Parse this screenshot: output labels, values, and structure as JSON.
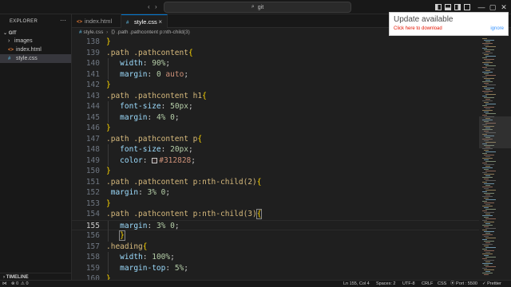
{
  "titlebar": {
    "search_text": "git"
  },
  "sidebar": {
    "title": "EXPLORER",
    "more": "···",
    "section": "GIT",
    "items": [
      {
        "label": "images",
        "icon": "folder-chevron-icon",
        "chevron": "›",
        "kind": "folder"
      },
      {
        "label": "index.html",
        "icon": "html-file-icon",
        "chevron": "",
        "kind": "file"
      },
      {
        "label": "style.css",
        "icon": "css-file-icon",
        "chevron": "",
        "kind": "file",
        "selected": true
      }
    ],
    "timeline": "TIMELINE"
  },
  "tabs": [
    {
      "label": "index.html",
      "icon": "<>",
      "active": false
    },
    {
      "label": "style.css",
      "icon": "#",
      "active": true,
      "close": "×"
    }
  ],
  "breadcrumb": {
    "file": "style.css",
    "separator": "›",
    "path": ".path .pathcontent p:nth-child(3)"
  },
  "editor": {
    "current_line": 155,
    "lines": [
      {
        "n": "138",
        "tokens": [
          [
            "brace",
            "}"
          ]
        ]
      },
      {
        "n": "139",
        "tokens": [
          [
            "sel",
            ".path .pathcontent"
          ],
          [
            "brace",
            "{"
          ]
        ]
      },
      {
        "n": "140",
        "indent": true,
        "tokens": [
          [
            "prop",
            "width"
          ],
          [
            "punc",
            ": "
          ],
          [
            "num",
            "90%"
          ],
          [
            "punc",
            ";"
          ]
        ]
      },
      {
        "n": "141",
        "indent": true,
        "tokens": [
          [
            "prop",
            "margin"
          ],
          [
            "punc",
            ": "
          ],
          [
            "num",
            "0"
          ],
          [
            "punc",
            " "
          ],
          [
            "val",
            "auto"
          ],
          [
            "punc",
            ";"
          ]
        ]
      },
      {
        "n": "142",
        "tokens": [
          [
            "brace",
            "}"
          ]
        ]
      },
      {
        "n": "143",
        "tokens": [
          [
            "sel",
            ".path .pathcontent h1"
          ],
          [
            "brace",
            "{"
          ]
        ]
      },
      {
        "n": "144",
        "indent": true,
        "tokens": [
          [
            "prop",
            "font-size"
          ],
          [
            "punc",
            ": "
          ],
          [
            "num",
            "50px"
          ],
          [
            "punc",
            ";"
          ]
        ]
      },
      {
        "n": "145",
        "indent": true,
        "tokens": [
          [
            "prop",
            "margin"
          ],
          [
            "punc",
            ": "
          ],
          [
            "num",
            "4% 0"
          ],
          [
            "punc",
            ";"
          ]
        ]
      },
      {
        "n": "146",
        "tokens": [
          [
            "brace",
            "}"
          ]
        ]
      },
      {
        "n": "147",
        "tokens": [
          [
            "sel",
            ".path .pathcontent p"
          ],
          [
            "brace",
            "{"
          ]
        ]
      },
      {
        "n": "148",
        "indent": true,
        "tokens": [
          [
            "prop",
            "font-size"
          ],
          [
            "punc",
            ": "
          ],
          [
            "num",
            "20px"
          ],
          [
            "punc",
            ";"
          ]
        ]
      },
      {
        "n": "149",
        "indent": true,
        "tokens": [
          [
            "prop",
            "color"
          ],
          [
            "punc",
            ": "
          ],
          [
            "swatch",
            ""
          ],
          [
            "val",
            "#312828"
          ],
          [
            "punc",
            ";"
          ]
        ]
      },
      {
        "n": "150",
        "tokens": [
          [
            "brace",
            "}"
          ]
        ]
      },
      {
        "n": "151",
        "tokens": [
          [
            "sel",
            ".path .pathcontent p:nth-child(2)"
          ],
          [
            "brace",
            "{"
          ]
        ]
      },
      {
        "n": "152",
        "tokens": [
          [
            "punc",
            " "
          ],
          [
            "prop",
            "margin"
          ],
          [
            "punc",
            ": "
          ],
          [
            "num",
            "3% 0"
          ],
          [
            "punc",
            ";"
          ]
        ]
      },
      {
        "n": "153",
        "tokens": [
          [
            "brace",
            "}"
          ]
        ]
      },
      {
        "n": "154",
        "tokens": [
          [
            "sel",
            ".path .pathcontent p:nth-child(3)"
          ],
          [
            "brace-box",
            "{"
          ]
        ]
      },
      {
        "n": "155",
        "indent": true,
        "tokens": [
          [
            "prop",
            "margin"
          ],
          [
            "punc",
            ": "
          ],
          [
            "num",
            "3% 0"
          ],
          [
            "punc",
            ";"
          ]
        ]
      },
      {
        "n": "156",
        "indent": true,
        "tokens": [
          [
            "brace-box",
            "}"
          ]
        ]
      },
      {
        "n": "157",
        "tokens": [
          [
            "sel",
            ".heading"
          ],
          [
            "brace",
            "{"
          ]
        ]
      },
      {
        "n": "158",
        "indent": true,
        "tokens": [
          [
            "prop",
            "width"
          ],
          [
            "punc",
            ": "
          ],
          [
            "num",
            "100%"
          ],
          [
            "punc",
            ";"
          ]
        ]
      },
      {
        "n": "159",
        "indent": true,
        "tokens": [
          [
            "prop",
            "margin-top"
          ],
          [
            "punc",
            ": "
          ],
          [
            "num",
            "5%"
          ],
          [
            "punc",
            ";"
          ]
        ]
      },
      {
        "n": "160",
        "tokens": [
          [
            "brace",
            "}"
          ]
        ]
      }
    ]
  },
  "notification": {
    "title": "Update available",
    "link": "Click here to download",
    "dismiss": "ignore"
  },
  "statusbar": {
    "errors": "⊗ 0",
    "warnings": "⚠ 0",
    "position": "Ln 155, Col 4",
    "spaces": "Spaces: 2",
    "encoding": "UTF-8",
    "eol": "CRLF",
    "language": "CSS",
    "port": "⦿ Port : 5500",
    "prettier": "✓ Prettier"
  },
  "colors": {
    "accent": "#0078d4",
    "selector": "#d7ba7d",
    "property": "#9cdcfe",
    "number": "#b5cea8",
    "value": "#ce9178",
    "brace": "#ffd700",
    "notification_link": "#e51400"
  }
}
